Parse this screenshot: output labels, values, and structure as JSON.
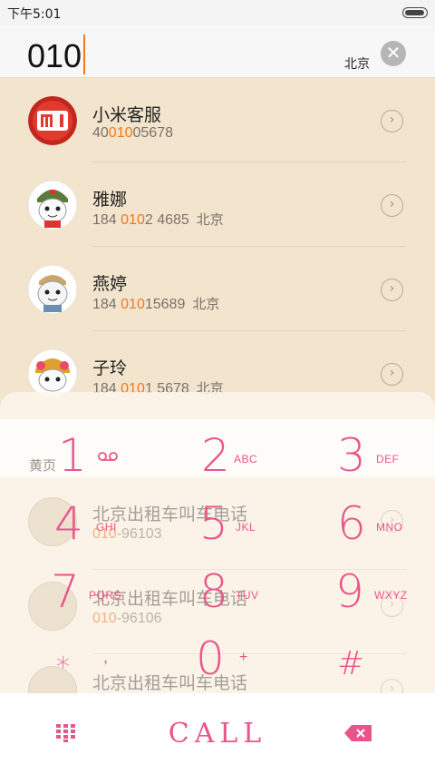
{
  "status": {
    "time": "下午5:01"
  },
  "search": {
    "input_value": "010",
    "region": "北京",
    "clear_icon": "close-icon"
  },
  "contacts": [
    {
      "name": "小米客服",
      "num_pre": "40",
      "num_hl": "010",
      "num_post": "05678",
      "location": "",
      "avatar": "mi-logo"
    },
    {
      "name": "雅娜",
      "num_pre": "184 ",
      "num_hl": "010",
      "num_post": "2 4685",
      "location": "北京",
      "avatar": "mitu-avatar"
    },
    {
      "name": "燕婷",
      "num_pre": "184 ",
      "num_hl": "010",
      "num_post": "15689",
      "location": "北京",
      "avatar": "mitu-avatar"
    },
    {
      "name": "子玲",
      "num_pre": "184 ",
      "num_hl": "010",
      "num_post": "1 5678",
      "location": "北京",
      "avatar": "mitu-avatar"
    }
  ],
  "yellow_pages": {
    "section_label": "黄页",
    "items": [
      {
        "name": "北京出租车叫车电话",
        "num_hl": "010",
        "num_post": "-96103"
      },
      {
        "name": "北京出租车叫车电话",
        "num_hl": "010",
        "num_post": "-96106"
      },
      {
        "name": "北京出租车叫车电话",
        "num_hl": "",
        "num_post": ""
      }
    ]
  },
  "keypad": {
    "keys": [
      {
        "digit": "1",
        "letters": ""
      },
      {
        "digit": "2",
        "letters": "ABC"
      },
      {
        "digit": "3",
        "letters": "DEF"
      },
      {
        "digit": "4",
        "letters": "GHI"
      },
      {
        "digit": "5",
        "letters": "JKL"
      },
      {
        "digit": "6",
        "letters": "MNO"
      },
      {
        "digit": "7",
        "letters": "PQRS"
      },
      {
        "digit": "8",
        "letters": "TUV"
      },
      {
        "digit": "9",
        "letters": "WXYZ"
      },
      {
        "digit": "*",
        "letters": ","
      },
      {
        "digit": "0",
        "letters": "+"
      },
      {
        "digit": "#",
        "letters": ""
      }
    ],
    "voicemail_icon": "voicemail-icon"
  },
  "bottom": {
    "call_label": "CALL",
    "keypad_icon": "dialpad-grid-icon",
    "delete_icon": "backspace-icon"
  },
  "colors": {
    "accent": "#e8558a",
    "highlight": "#f07a1a",
    "background": "#f3e4cd"
  }
}
